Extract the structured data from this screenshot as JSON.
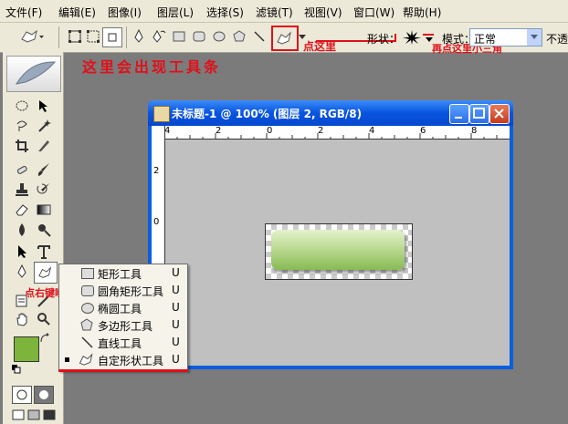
{
  "menubar": {
    "items": [
      "文件(F)",
      "编辑(E)",
      "图像(I)",
      "图层(L)",
      "选择(S)",
      "滤镜(T)",
      "视图(V)",
      "窗口(W)",
      "帮助(H)"
    ]
  },
  "options": {
    "shape_label": "形状：",
    "mode_label": "模式：",
    "mode_value": "正常",
    "opacity_label": "不透"
  },
  "annotations": {
    "toolbar_hint": "这里会出现工具条",
    "click_here": "点这里",
    "click_triangle": "再点这里小三角",
    "right_click": "点右键哟"
  },
  "document": {
    "title": "未标题-1 @ 100% (图层 2, RGB/8)",
    "ruler_top": [
      "4",
      "2",
      "0",
      "2",
      "4",
      "6",
      "8"
    ],
    "ruler_left": [
      "2",
      "0"
    ]
  },
  "flyout": {
    "items": [
      {
        "label": "矩形工具",
        "key": "U",
        "icon": "rect-icon",
        "selected": false
      },
      {
        "label": "圆角矩形工具",
        "key": "U",
        "icon": "rounded-rect-icon",
        "selected": false
      },
      {
        "label": "椭圆工具",
        "key": "U",
        "icon": "ellipse-icon",
        "selected": false
      },
      {
        "label": "多边形工具",
        "key": "U",
        "icon": "polygon-icon",
        "selected": false
      },
      {
        "label": "直线工具",
        "key": "U",
        "icon": "line-icon",
        "selected": false
      },
      {
        "label": "自定形状工具",
        "key": "U",
        "icon": "custom-shape-icon",
        "selected": true
      }
    ]
  },
  "colors": {
    "annotation_red": "#e0101a",
    "foreground": "#7db53c",
    "background": "#ffffff",
    "shape_gradient_top": "#e0f0c8",
    "shape_gradient_bottom": "#8ec05a"
  }
}
